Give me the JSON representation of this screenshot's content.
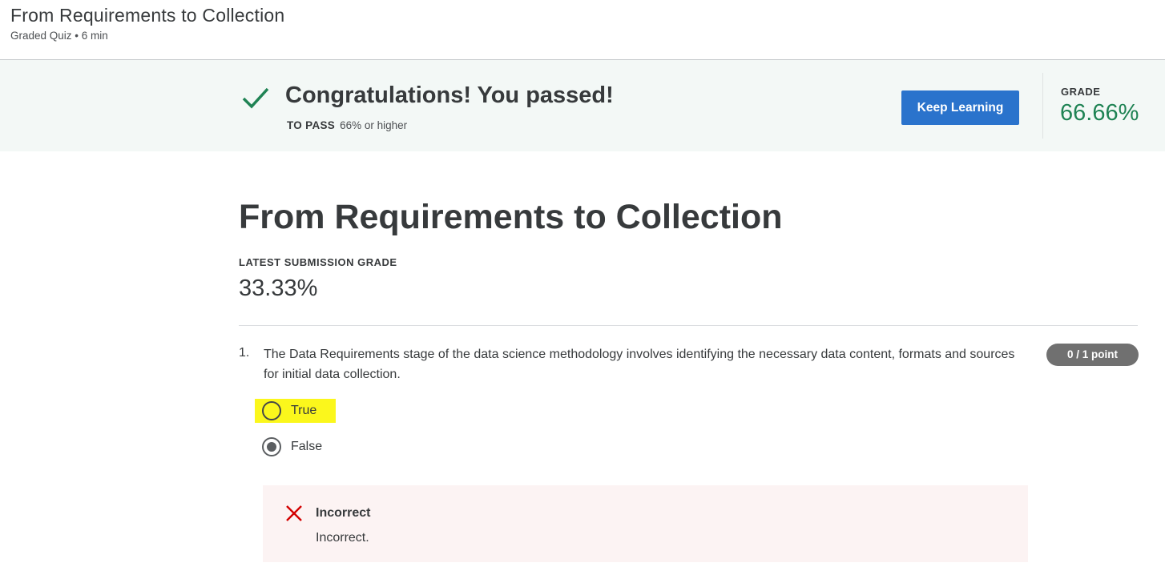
{
  "header": {
    "title": "From Requirements to Collection",
    "subtitle": "Graded Quiz • 6 min"
  },
  "banner": {
    "title": "Congratulations! You passed!",
    "to_pass_label": "TO PASS",
    "to_pass_value": "66% or higher",
    "button_label": "Keep Learning",
    "grade_label": "GRADE",
    "grade_value": "66.66%"
  },
  "quiz": {
    "title": "From Requirements to Collection",
    "latest_label": "LATEST SUBMISSION GRADE",
    "latest_value": "33.33%"
  },
  "question": {
    "number": "1.",
    "text": "The Data Requirements stage of the data science methodology involves identifying the necessary data content, formats and sources for initial data collection.",
    "points": "0 / 1 point",
    "options": [
      {
        "label": "True",
        "selected": false,
        "highlighted": true
      },
      {
        "label": "False",
        "selected": true,
        "highlighted": false
      }
    ],
    "feedback": {
      "title": "Incorrect",
      "text": "Incorrect."
    }
  },
  "colors": {
    "accent_button": "#2a73cc",
    "success_green": "#1f8354",
    "error_red": "#d30000",
    "highlight_yellow": "#fbf71c",
    "banner_bg": "#f3f8f6",
    "feedback_bg": "#fcf3f3"
  },
  "icons": {
    "check": "check-icon",
    "error": "x-icon"
  }
}
